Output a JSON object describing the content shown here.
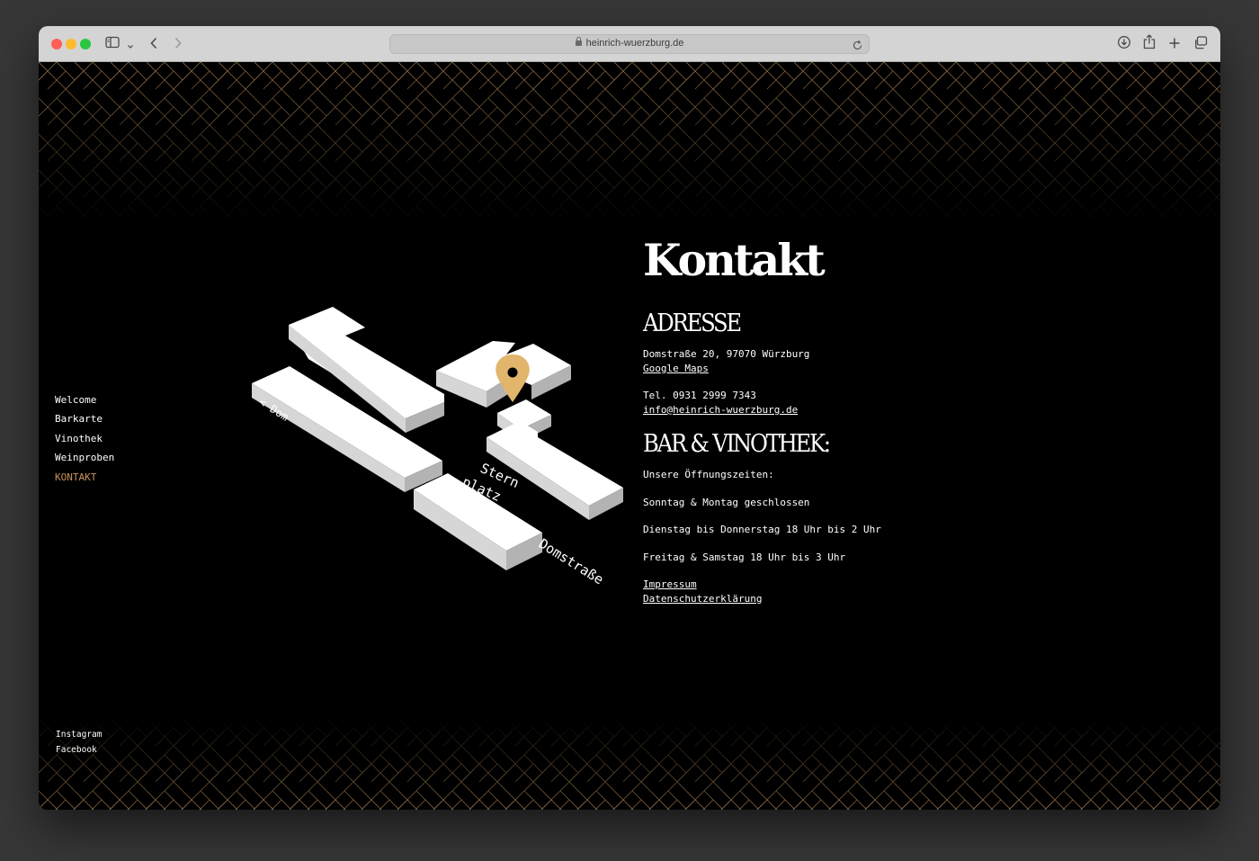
{
  "browser": {
    "url": "heinrich-wuerzburg.de"
  },
  "nav": {
    "items": [
      {
        "label": "Welcome"
      },
      {
        "label": "Barkarte"
      },
      {
        "label": "Vinothek"
      },
      {
        "label": "Weinproben"
      },
      {
        "label": "KONTAKT",
        "active": true
      }
    ]
  },
  "social": {
    "instagram": "Instagram",
    "facebook": "Facebook"
  },
  "map": {
    "label_dom": "< Dom",
    "label_sternplatz_1": "Stern",
    "label_sternplatz_2": "platz",
    "label_domstrasse": "Domstraße",
    "pin_color": "#e1b56b"
  },
  "contact": {
    "title": "Kontakt",
    "address_heading": "ADRESSE",
    "address": "Domstraße 20, 97070 Würzburg",
    "maps_link": "Google Maps",
    "phone": "Tel. 0931 2999 7343",
    "email": "info@heinrich-wuerzburg.de",
    "bar_heading": "BAR & VINOTHEK:",
    "hours_intro": "Unsere Öffnungszeiten:",
    "hours_1": "Sonntag & Montag geschlossen",
    "hours_2": "Dienstag bis Donnerstag 18 Uhr bis 2 Uhr",
    "hours_3": "Freitag & Samstag 18 Uhr bis 3 Uhr",
    "impressum": "Impressum",
    "datenschutz": "Datenschutzerklärung"
  },
  "colors": {
    "accent": "#c9935c",
    "pattern_line": "#9a7448",
    "background": "#000000"
  }
}
